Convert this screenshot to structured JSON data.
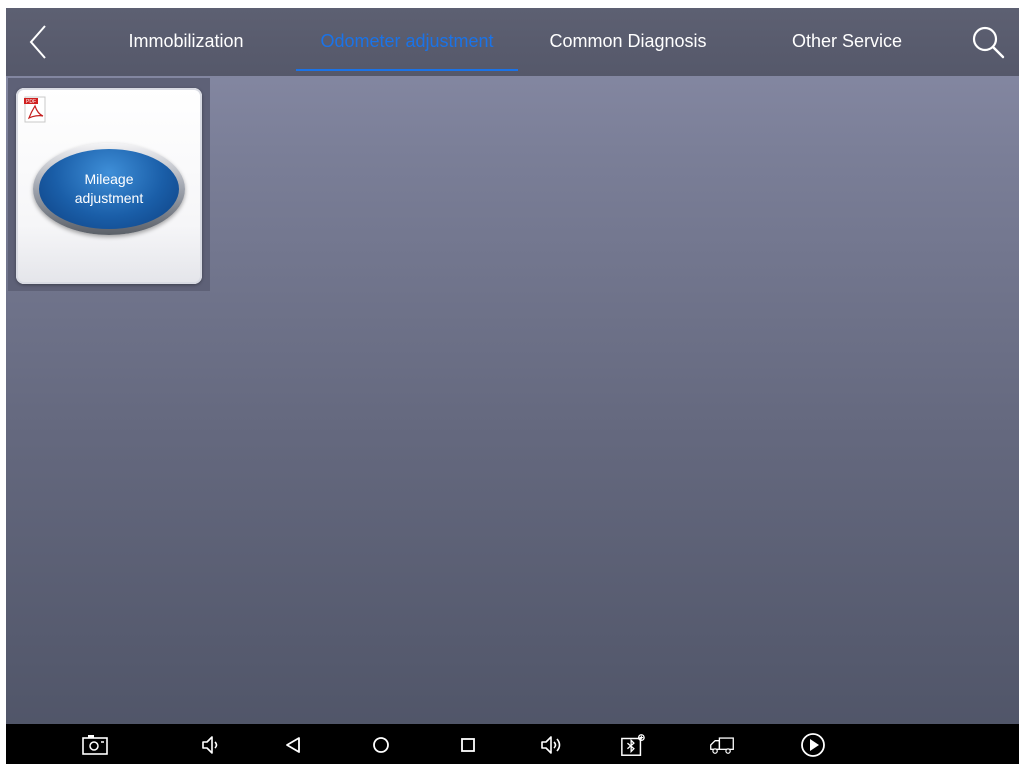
{
  "header": {
    "back_icon": "chevron-left-icon",
    "tabs": [
      {
        "label": "Immobilization",
        "active": false
      },
      {
        "label": "Odometer adjustment",
        "active": true
      },
      {
        "label": "Common Diagnosis",
        "active": false
      },
      {
        "label": "Other Service",
        "active": false
      }
    ],
    "search_icon": "search-icon"
  },
  "content": {
    "items": [
      {
        "label_line1": "Mileage",
        "label_line2": "adjustment",
        "badge_icon": "pdf-icon",
        "badge_text": "PDF"
      }
    ]
  },
  "navbar": {
    "icons": [
      "screenshot-icon",
      "volume-down-icon",
      "back-triangle-icon",
      "home-circle-icon",
      "recents-square-icon",
      "volume-up-icon",
      "vci-connect-icon",
      "vehicle-icon",
      "play-icon"
    ]
  },
  "colors": {
    "accent": "#1a73e8",
    "tab_text": "#ffffff",
    "header_bg": "#5d6072",
    "navbar_bg": "#000000"
  }
}
